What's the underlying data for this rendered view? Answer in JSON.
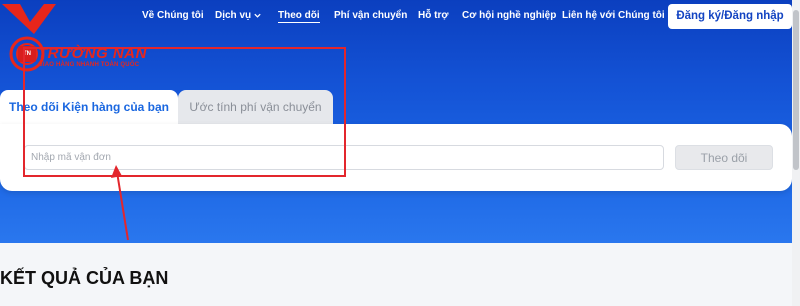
{
  "nav": {
    "items": [
      {
        "label": "Về Chúng tôi"
      },
      {
        "label": "Dịch vụ"
      },
      {
        "label": "Theo dõi"
      },
      {
        "label": "Phí vận chuyển"
      },
      {
        "label": "Hỗ trợ"
      },
      {
        "label": "Cơ hội nghề nghiệp"
      },
      {
        "label": "Liên hệ với Chúng tôi"
      }
    ],
    "cta_label": "Đăng ký/Đăng nhập"
  },
  "logo": {
    "badge": "TN",
    "name": "TRƯỜNG NAN",
    "tagline": "GIAO HÀNG NHANH TOÀN QUỐC"
  },
  "tabs": [
    {
      "label": "Theo dõi Kiện hàng của bạn"
    },
    {
      "label": "Ước tính phí vận chuyển"
    }
  ],
  "search": {
    "placeholder": "Nhập mã vận đơn",
    "value": "",
    "button_label": "Theo dõi"
  },
  "results": {
    "title": "KẾT QUẢ CỦA BẠN"
  },
  "colors": {
    "hero": "#1453d6",
    "accent": "#1a67e0",
    "annotation": "#e3262c"
  }
}
